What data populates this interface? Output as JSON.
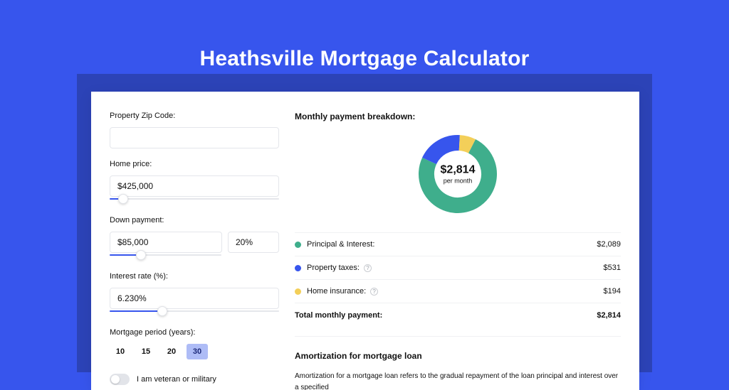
{
  "page": {
    "title": "Heathsville Mortgage Calculator"
  },
  "form": {
    "zip_label": "Property Zip Code:",
    "zip_value": "",
    "home_price_label": "Home price:",
    "home_price_value": "$425,000",
    "down_payment_label": "Down payment:",
    "down_payment_amount": "$85,000",
    "down_payment_pct": "20%",
    "interest_label": "Interest rate (%):",
    "interest_value": "6.230%",
    "period_label": "Mortgage period (years):",
    "period_options": [
      "10",
      "15",
      "20",
      "30"
    ],
    "period_selected": "30",
    "veteran_label": "I am veteran or military"
  },
  "breakdown": {
    "title": "Monthly payment breakdown:",
    "center_value": "$2,814",
    "center_sub": "per month",
    "rows": [
      {
        "label": "Principal & Interest:",
        "value": "$2,089",
        "color": "#3FAE8C",
        "help": false
      },
      {
        "label": "Property taxes:",
        "value": "$531",
        "color": "#3755ED",
        "help": true
      },
      {
        "label": "Home insurance:",
        "value": "$194",
        "color": "#F3CF59",
        "help": true
      }
    ],
    "total_label": "Total monthly payment:",
    "total_value": "$2,814"
  },
  "amortization": {
    "title": "Amortization for mortgage loan",
    "text": "Amortization for a mortgage loan refers to the gradual repayment of the loan principal and interest over a specified"
  },
  "chart_data": {
    "type": "pie",
    "title": "Monthly payment breakdown",
    "series": [
      {
        "name": "Principal & Interest",
        "value": 2089,
        "color": "#3FAE8C"
      },
      {
        "name": "Property taxes",
        "value": 531,
        "color": "#3755ED"
      },
      {
        "name": "Home insurance",
        "value": 194,
        "color": "#F3CF59"
      }
    ],
    "total": 2814,
    "center_label": "$2,814 per month"
  }
}
